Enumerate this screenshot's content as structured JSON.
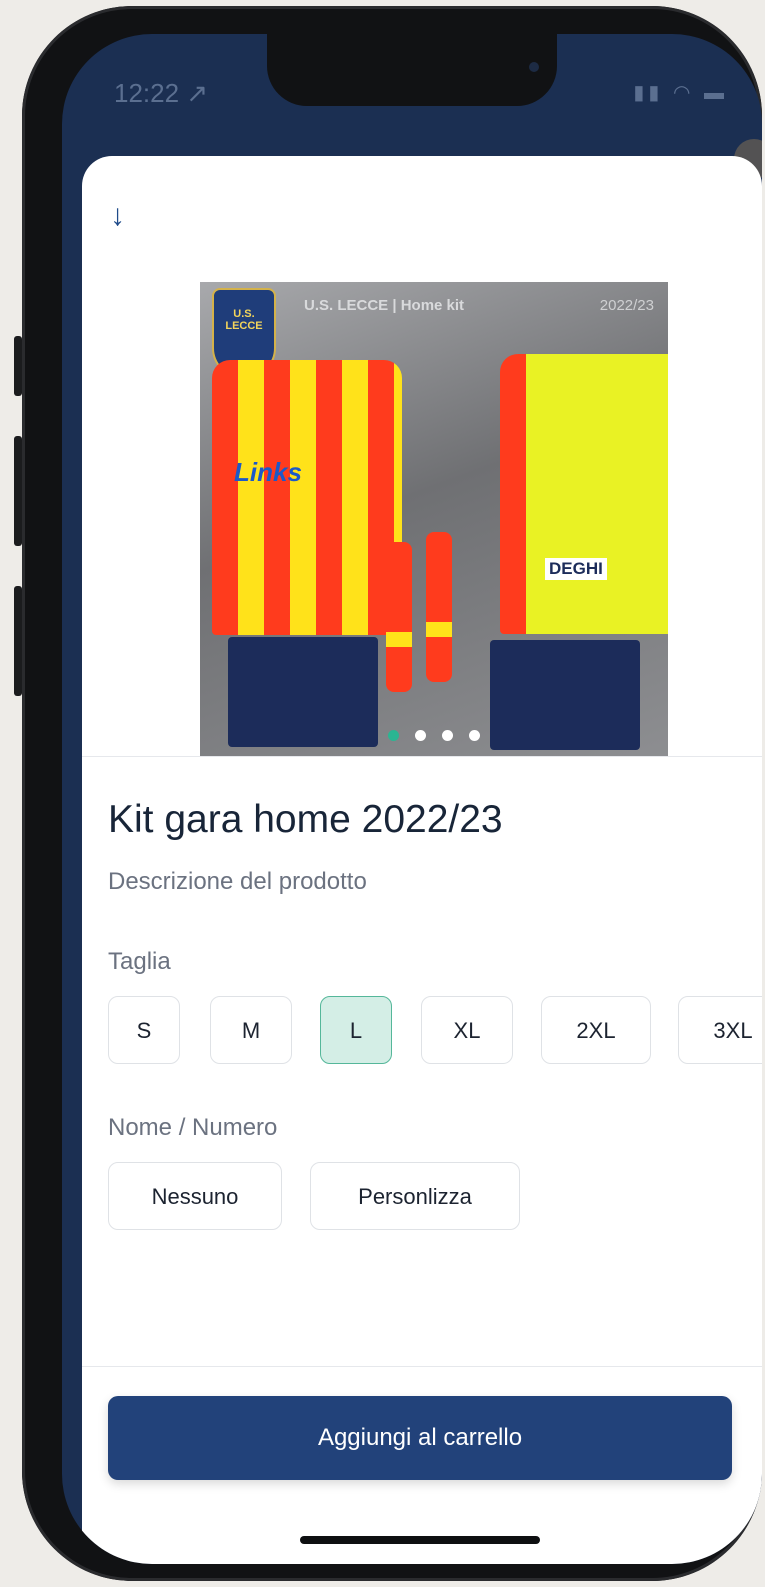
{
  "status_bar": {
    "time": "12:22 ↗",
    "icons": "signal-icon wifi-icon battery-icon"
  },
  "sheet": {
    "close_icon": "↓",
    "product_image": {
      "banner_title": "U.S. LECCE | Home kit",
      "banner_season": "2022/23",
      "crest_text": "U.S. LECCE",
      "sponsor_front": "Links",
      "sponsor_back": "DEGHI",
      "carousel_dots": 4,
      "active_dot": 0
    },
    "title": "Kit gara home 2022/23",
    "description": "Descrizione del prodotto",
    "size_label": "Taglia",
    "sizes": [
      "S",
      "M",
      "L",
      "XL",
      "2XL",
      "3XL"
    ],
    "selected_size": "L",
    "name_label": "Nome / Numero",
    "name_options": [
      "Nessuno",
      "Personlizza"
    ],
    "cart_button": "Aggiungi al carrello"
  },
  "colors": {
    "primary": "#22427a",
    "accent": "#2bb592",
    "selected_bg": "#d4eee6",
    "header_bg": "#1b2f52"
  }
}
